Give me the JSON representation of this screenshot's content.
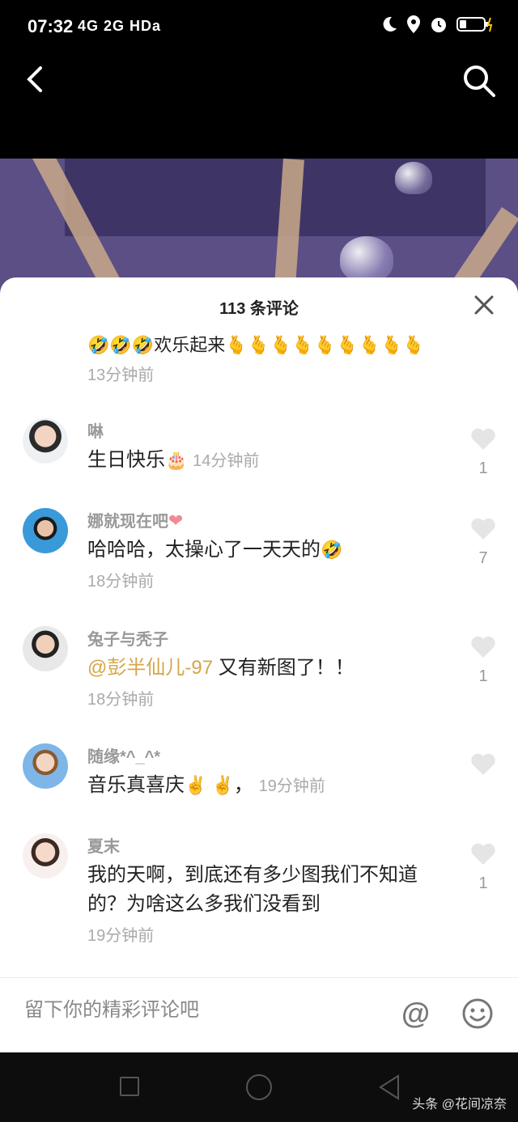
{
  "status": {
    "time": "07:32",
    "network": "4G 2G HDa"
  },
  "sheet": {
    "title": "113 条评论",
    "first_comment": {
      "text": "欢乐起来",
      "time": "13分钟前"
    }
  },
  "comments": [
    {
      "user": "啉",
      "text": "生日快乐",
      "time": "14分钟前",
      "likes": "1"
    },
    {
      "user": "娜就现在吧",
      "text": "哈哈哈，太操心了一天天的",
      "time": "18分钟前",
      "likes": "7"
    },
    {
      "user": "兔子与秃子",
      "mention": "@彭半仙儿-97",
      "text": " 又有新图了！！",
      "time": "18分钟前",
      "likes": "1"
    },
    {
      "user": "随缘*^_^*",
      "text": "音乐真喜庆",
      "suffix": "，",
      "time": "19分钟前",
      "likes": ""
    },
    {
      "user": "夏末",
      "text": "我的天啊，到底还有多少图我们不知道的？为啥这么多我们没看到",
      "time": "19分钟前",
      "likes": "1"
    }
  ],
  "input": {
    "placeholder": "留下你的精彩评论吧",
    "at_label": "@"
  },
  "watermark": "头条 @花间凉奈"
}
